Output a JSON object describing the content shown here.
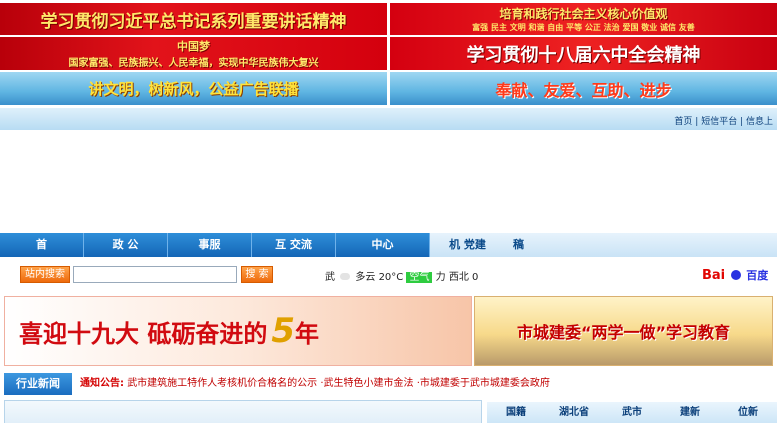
{
  "banners": {
    "top_left": "学习贯彻习近平总书记系列重要讲话精神",
    "top_right_line1": "培育和践行社会主义核心价值观",
    "top_right_line2": "富强 民主 文明 和谐  自由 平等 公正 法治  爱国 敬业 诚信 友善",
    "mid_left_title": "中国梦",
    "mid_left_sub": "国家富强、民族振兴、人民幸福，实现中华民族伟大复兴",
    "mid_right": "学习贯彻十八届六中全会精神",
    "bottom_left": "讲文明，树新风，公益广告联播",
    "bottom_right": "奉献、友爱、互助、进步"
  },
  "toplinks": {
    "home": "首页",
    "sms": "短信平台",
    "info": "信息上"
  },
  "nav": {
    "items": [
      "首",
      "政 公",
      "事服",
      "互 交流",
      "中心",
      "机 党建",
      "稿"
    ]
  },
  "search": {
    "label": "站内搜索",
    "placeholder": "",
    "button": "搜 索"
  },
  "weather": {
    "city": "武",
    "condition": "多云",
    "temp": "20°C",
    "aqi_label": "空气",
    "wind": "力 西北",
    "wind_level": "0"
  },
  "baidu": {
    "text1": "Bai",
    "text2": "百度"
  },
  "promo": {
    "left": "喜迎十九大 砥砺奋进的",
    "left_num": "5",
    "left_tail": "年",
    "right": "市城建委“两学一做”学习教育"
  },
  "news": {
    "section_title": "行业新闻",
    "notice_label": "通知公告:",
    "ticker": "武市建筑施工特作人考核机价合格名的公示 ·武生特色小建市金法 ·市城建委于武市城建委会政府"
  },
  "region_tabs": [
    "国籍",
    "湖北省",
    "武市",
    "建新",
    "位新"
  ],
  "colors": {
    "nav_blue": "#1466b6",
    "accent_orange": "#ee6a0c",
    "banner_red": "#e2131a",
    "ticker_red": "#d40000"
  }
}
